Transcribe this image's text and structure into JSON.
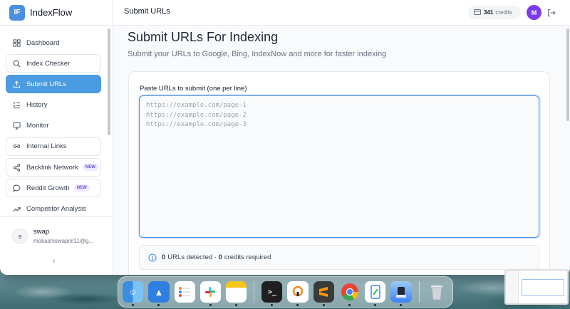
{
  "app": {
    "logo": "IF",
    "name": "IndexFlow"
  },
  "sidebar": {
    "items": [
      {
        "label": "Dashboard",
        "icon": "grid-icon"
      },
      {
        "label": "Index Checker",
        "icon": "search-icon"
      },
      {
        "label": "Submit URLs",
        "icon": "upload-icon"
      },
      {
        "label": "History",
        "icon": "checklist-icon"
      },
      {
        "label": "Monitor",
        "icon": "monitor-icon"
      },
      {
        "label": "Internal Links",
        "icon": "link-icon"
      },
      {
        "label": "Backlink Network",
        "icon": "share-icon",
        "badge": "NEW"
      },
      {
        "label": "Reddit Growth",
        "icon": "chat-icon",
        "badge": "NEW"
      },
      {
        "label": "Competitor Analysis",
        "icon": "trend-icon"
      }
    ],
    "user": {
      "initial": "s",
      "name": "swap",
      "email": "mokashiswapnil11@g..."
    },
    "collapse": "‹"
  },
  "header": {
    "title": "Submit URLs",
    "credits_value": "341",
    "credits_label": "credits",
    "avatar": "M"
  },
  "main": {
    "title": "Submit URLs For Indexing",
    "subtitle": "Submit your URLs to Google, Bing, IndexNow and more for faster indexing",
    "field_label": "Paste URLs to submit (one per line)",
    "placeholder": "https://example.com/page-1\nhttps://example.com/page-2\nhttps://example.com/page-3",
    "detect_count": "0",
    "detect_text_1": "URLs detected · ",
    "detect_credits": "0",
    "detect_text_2": "credits required"
  },
  "colors": {
    "accent": "#4a9be0",
    "avatar": "#7c3aed",
    "badge": "#6d4fd6"
  },
  "dock": {
    "apps": [
      "finder-icon",
      "keynote-icon",
      "reminders-icon",
      "slack-icon",
      "notes-icon",
      "terminal-icon",
      "vpn-icon",
      "sublime-icon",
      "chrome-icon",
      "phone-mirror-icon",
      "simulator-icon",
      "trash-icon"
    ]
  }
}
